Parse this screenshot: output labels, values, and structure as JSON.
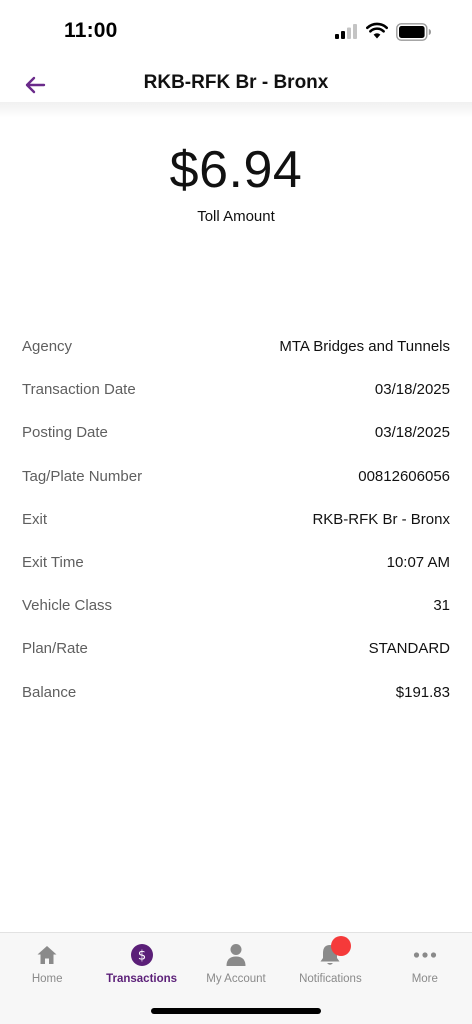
{
  "status_bar": {
    "time": "11:00"
  },
  "header": {
    "title": "RKB-RFK Br - Bronx"
  },
  "toll": {
    "amount": "$6.94",
    "label": "Toll Amount"
  },
  "details": [
    {
      "label": "Agency",
      "value": "MTA Bridges and Tunnels"
    },
    {
      "label": "Transaction Date",
      "value": "03/18/2025"
    },
    {
      "label": "Posting Date",
      "value": "03/18/2025"
    },
    {
      "label": "Tag/Plate Number",
      "value": "00812606056"
    },
    {
      "label": "Exit",
      "value": "RKB-RFK Br - Bronx"
    },
    {
      "label": "Exit Time",
      "value": "10:07 AM"
    },
    {
      "label": "Vehicle Class",
      "value": "31"
    },
    {
      "label": "Plan/Rate",
      "value": "STANDARD"
    },
    {
      "label": "Balance",
      "value": "$191.83"
    }
  ],
  "tab_bar": {
    "tabs": [
      {
        "label": "Home",
        "icon": "home-icon"
      },
      {
        "label": "Transactions",
        "icon": "dollar-icon",
        "active": true
      },
      {
        "label": "My Account",
        "icon": "person-icon"
      },
      {
        "label": "Notifications",
        "icon": "bell-icon"
      },
      {
        "label": "More",
        "icon": "more-icon"
      }
    ]
  },
  "colors": {
    "accent": "#5b1f78",
    "badge": "#f53a3a",
    "label_gray": "#5f5f5f",
    "tab_gray": "#8a8a8a"
  }
}
